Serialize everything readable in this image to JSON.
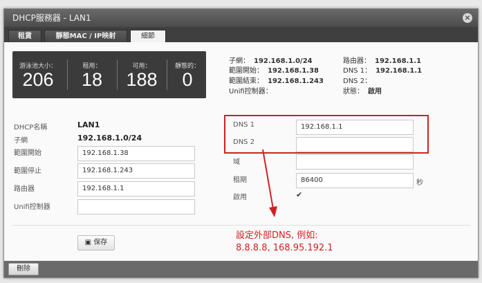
{
  "window": {
    "title": "DHCP服務器 - LAN1",
    "close_icon": "close-icon"
  },
  "tabs": [
    {
      "label": "租賃",
      "active": false
    },
    {
      "label": "靜態MAC / IP映射",
      "active": false
    },
    {
      "label": "細節",
      "active": true
    }
  ],
  "stats": [
    {
      "label": "游泳池大小：",
      "value": "206"
    },
    {
      "label": "租用：",
      "value": "18"
    },
    {
      "label": "可用：",
      "value": "188"
    },
    {
      "label": "靜態的：",
      "value": "0"
    }
  ],
  "summary": {
    "subnet_label": "子網：",
    "subnet_value": "192.168.1.0/24",
    "range_start_label": "範圍開始：",
    "range_start_value": "192.168.1.38",
    "range_end_label": "範圍結束：",
    "range_end_value": "192.168.1.243",
    "unifi_label": "Unifi控制器：",
    "unifi_value": "",
    "router_label": "路由器：",
    "router_value": "192.168.1.1",
    "dns1_label": "DNS 1：",
    "dns1_value": "192.168.1.1",
    "dns2_label": "DNS 2：",
    "dns2_value": "",
    "status_label": "狀態：",
    "status_value": "啟用"
  },
  "form": {
    "dhcp_name_label": "DHCP名稱",
    "dhcp_name_value": "LAN1",
    "subnet_label": "子網",
    "subnet_value": "192.168.1.0/24",
    "range_start_label": "範圍開始",
    "range_start_value": "192.168.1.38",
    "range_stop_label": "範圍停止",
    "range_stop_value": "192.168.1.243",
    "router_label": "路由器",
    "router_value": "192.168.1.1",
    "unifi_label": "Unifi控制器",
    "unifi_value": "",
    "dns1_label": "DNS 1",
    "dns1_value": "192.168.1.1",
    "dns2_label": "DNS 2",
    "dns2_value": "",
    "domain_label": "域",
    "domain_value": "",
    "lease_label": "租期",
    "lease_value": "86400",
    "lease_unit": "秒",
    "enable_label": "啟用",
    "enable_checked": true
  },
  "buttons": {
    "save_label": "保存",
    "delete_label": "刪除"
  },
  "annotation": {
    "line1": "設定外部DNS, 例如:",
    "line2": "8.8.8.8, 168.95.192.1",
    "color": "#d12020"
  }
}
